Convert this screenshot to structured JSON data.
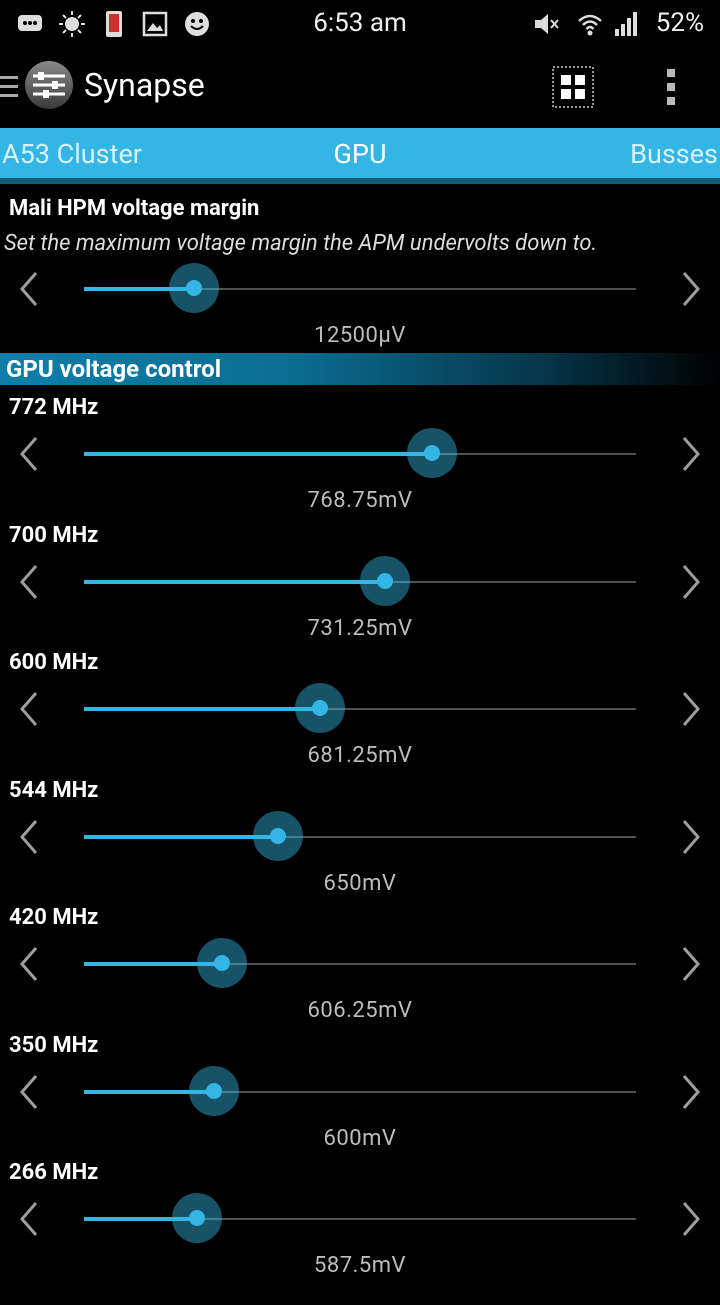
{
  "status_bar": {
    "time": "6:53 am",
    "battery": "52%",
    "icons": [
      "chat-icon",
      "brightness-icon",
      "phone-alert-icon",
      "image-icon",
      "smiley-icon",
      "mute-icon",
      "wifi-icon",
      "signal-icon"
    ]
  },
  "action_bar": {
    "app_title": "Synapse",
    "icons": [
      "menu-icon",
      "app-logo",
      "grid-icon",
      "overflow-icon"
    ]
  },
  "tabs": {
    "left": "A53 Cluster",
    "current": "GPU",
    "right": "Busses"
  },
  "mali": {
    "title": "Mali HPM voltage margin",
    "description": "Set the maximum voltage margin the APM undervolts down to.",
    "value": "12500µV",
    "level": 0.2
  },
  "gpu_section": {
    "title": "GPU voltage control",
    "rows": [
      {
        "label": "772 MHz",
        "value": "768.75mV",
        "level": 0.63
      },
      {
        "label": "700 MHz",
        "value": "731.25mV",
        "level": 0.545
      },
      {
        "label": "600 MHz",
        "value": "681.25mV",
        "level": 0.428
      },
      {
        "label": "544 MHz",
        "value": "650mV",
        "level": 0.352
      },
      {
        "label": "420 MHz",
        "value": "606.25mV",
        "level": 0.25
      },
      {
        "label": "350 MHz",
        "value": "600mV",
        "level": 0.235
      },
      {
        "label": "266 MHz",
        "value": "587.5mV",
        "level": 0.205
      }
    ]
  },
  "colors": {
    "accent": "#33b5e5",
    "background": "#000000",
    "value_text": "#bdbdbd"
  }
}
